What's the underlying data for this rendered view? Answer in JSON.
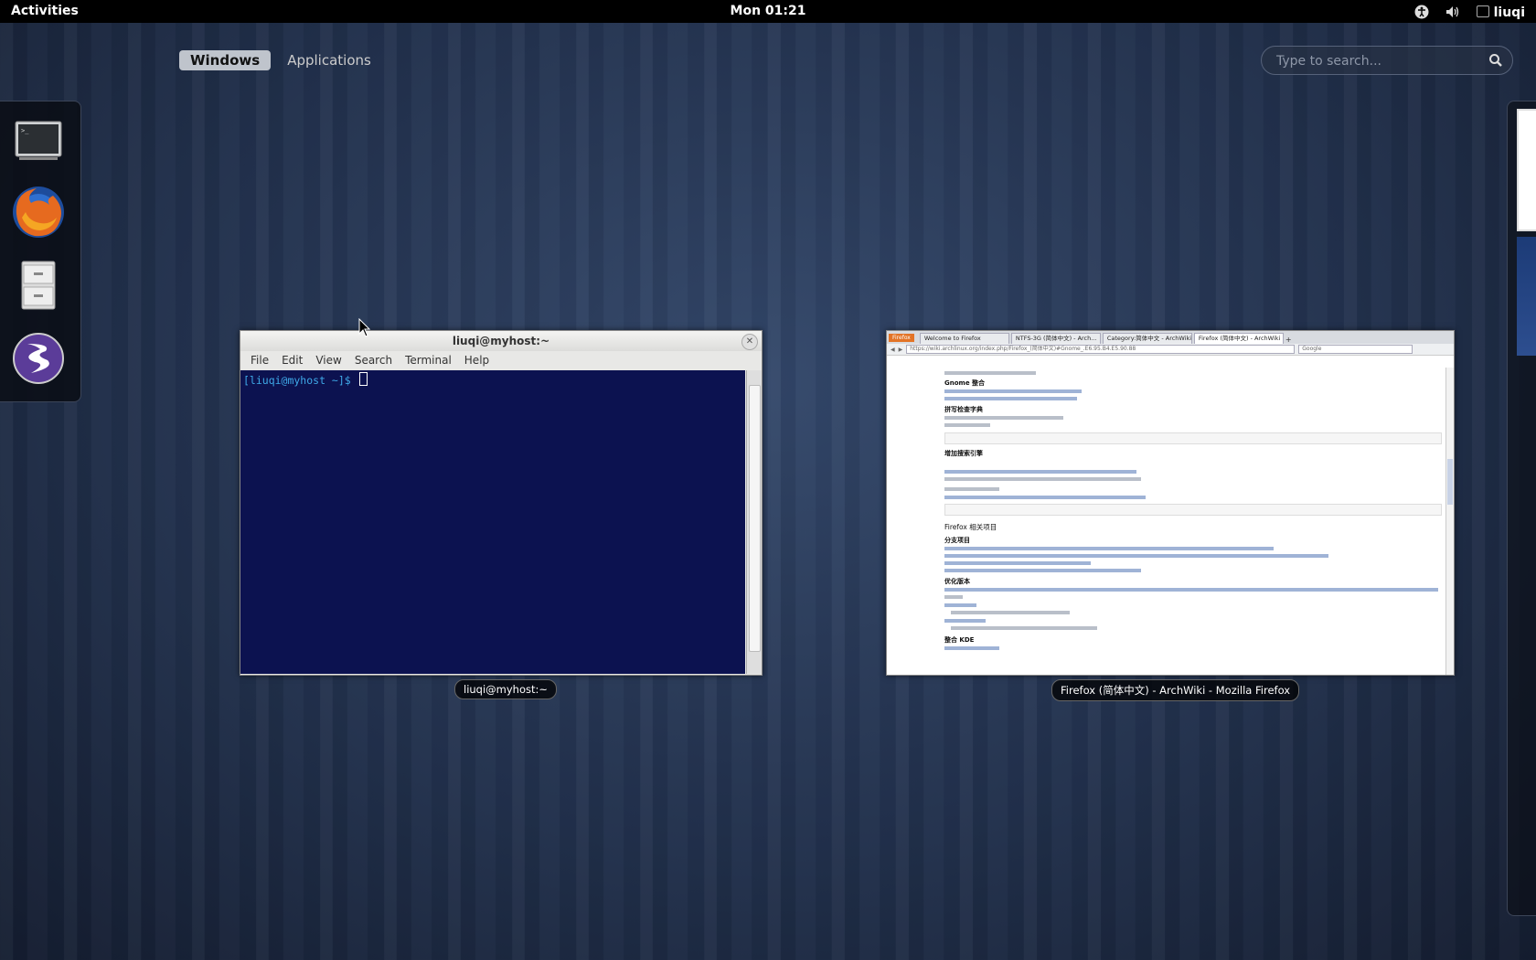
{
  "topbar": {
    "activities": "Activities",
    "clock": "Mon 01:21",
    "username": "liuqi"
  },
  "view_selector": {
    "windows": "Windows",
    "applications": "Applications"
  },
  "search": {
    "placeholder": "Type to search..."
  },
  "dash": [
    {
      "name": "terminal-icon"
    },
    {
      "name": "firefox-icon"
    },
    {
      "name": "file-cabinet-icon"
    },
    {
      "name": "emacs-icon"
    }
  ],
  "terminal": {
    "title": "liuqi@myhost:~",
    "menu": [
      "File",
      "Edit",
      "View",
      "Search",
      "Terminal",
      "Help"
    ],
    "prompt": "[liuqi@myhost ~]$ ",
    "caption": "liuqi@myhost:~"
  },
  "firefox": {
    "menu_button": "Firefox",
    "tabs": [
      "Welcome to Firefox",
      "NTFS-3G (简体中文) - Arch...",
      "Category:简体中文 - ArchWiki",
      "Firefox (简体中文) - ArchWiki"
    ],
    "url": "https://wiki.archlinux.org/index.php/Firefox_(简体中文)#Gnome_.E6.95.B4.E5.90.88",
    "search_placeholder": "Google",
    "headings": [
      "Gnome 整合",
      "拼写检查字典",
      "增加搜索引擎",
      "Firefox 相关项目",
      "分支项目",
      "优化版本",
      "整合 KDE"
    ],
    "caption": "Firefox (简体中文) - ArchWiki - Mozilla Firefox"
  },
  "colors": {
    "terminal_bg": "#0c1250",
    "terminal_fg": "#3fa9e8",
    "firefox_button": "#e37427"
  }
}
